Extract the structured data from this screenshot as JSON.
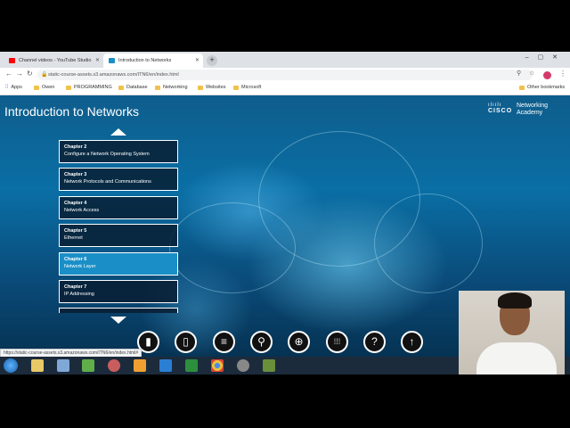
{
  "browser": {
    "tabs": [
      {
        "label": "Channel videos - YouTube Studio",
        "favicon_color": "#ff0000"
      },
      {
        "label": "Introduction to Networks",
        "favicon_color": "#1a8fc7"
      }
    ],
    "url": "static-course-assets.s3.amazonaws.com/ITN6/en/index.html",
    "bookmarks": [
      "Apps",
      "Owen",
      "PROGRAMMING",
      "Database",
      "Networking",
      "Websites",
      "Microsoft"
    ],
    "other_bookmarks": "Other bookmarks",
    "status_url": "https://static-course-assets.s3.amazonaws.com/ITN6/en/index.html#"
  },
  "page": {
    "title": "Introduction to Networks",
    "logo": {
      "brand": "CISCO",
      "line1": "Networking",
      "line2": "Academy"
    },
    "chapters": [
      {
        "number": "Chapter 2",
        "title": "Configure a Network Operating System",
        "active": false
      },
      {
        "number": "Chapter 3",
        "title": "Network Protocols and Communications",
        "active": false
      },
      {
        "number": "Chapter 4",
        "title": "Network Access",
        "active": false
      },
      {
        "number": "Chapter 5",
        "title": "Ethernet",
        "active": false
      },
      {
        "number": "Chapter 6",
        "title": "Network Layer",
        "active": true
      },
      {
        "number": "Chapter 7",
        "title": "IP Addressing",
        "active": false
      }
    ],
    "toolbar_icons": [
      "book-icon",
      "bookmark-icon",
      "menu-icon",
      "search-icon",
      "zoom-icon",
      "grid-icon",
      "help-icon",
      "up-arrow-icon"
    ],
    "toolbar_glyphs": [
      "▮",
      "▯",
      "≡",
      "⚲",
      "⊕",
      "⁞⁞⁞",
      "?",
      "↑"
    ]
  },
  "taskbar": {
    "icon_colors": [
      "#e8c867",
      "#7fa8d6",
      "#5fae4a",
      "#c95d5d",
      "#f0a030",
      "#2a7fd4",
      "#2c8f3c",
      "#e6c23c",
      "#888888",
      "#6a8f3a"
    ]
  }
}
